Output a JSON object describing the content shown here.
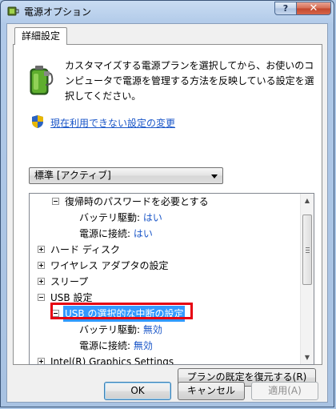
{
  "window": {
    "title": "電源オプション",
    "help_label": "?",
    "close_label": "✕"
  },
  "tab": {
    "label": "詳細設定"
  },
  "description": "カスタマイズする電源プランを選択してから、お使いのコンピュータで電源を管理する方法を反映している設定を選択してください。",
  "link_text": "現在利用できない設定の変更",
  "plan_select": {
    "value": "標準 [アクティブ]"
  },
  "tree": {
    "password_on_resume": "復帰時のパスワードを必要とする",
    "on_battery_label": "バッテリ駆動:",
    "password_on_battery_value": "はい",
    "plugged_in_label": "電源に接続:",
    "password_plugged_in_value": "はい",
    "hard_disk": "ハード ディスク",
    "wireless_adapter": "ワイヤレス アダプタの設定",
    "sleep": "スリープ",
    "usb_settings": "USB 設定",
    "usb_selective_suspend": "USB の選択的な中断の設定",
    "usb_on_battery_value": "無効",
    "usb_plugged_in_value": "無効",
    "intel_graphics": "Intel(R) Graphics Settings"
  },
  "buttons": {
    "restore_defaults": "プランの既定を復元する(R)",
    "ok": "OK",
    "cancel": "キャンセル",
    "apply": "適用(A)"
  },
  "colors": {
    "link": "#1a56c8",
    "selection": "#3399ff",
    "highlight_box": "#e60012"
  }
}
